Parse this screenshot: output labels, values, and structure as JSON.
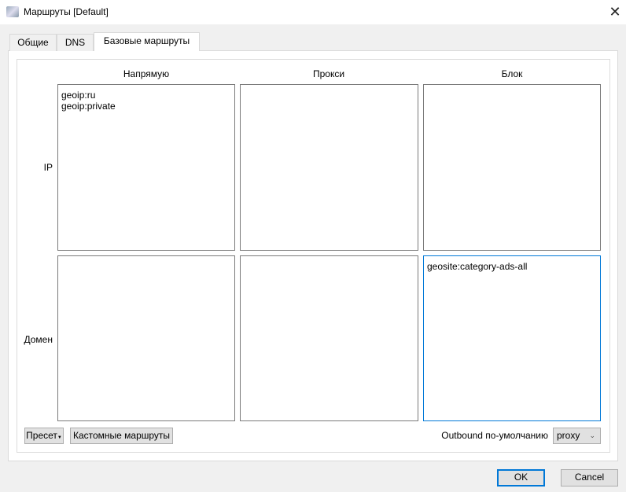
{
  "window": {
    "title": "Маршруты [Default]"
  },
  "tabs": [
    {
      "label": "Общие"
    },
    {
      "label": "DNS"
    },
    {
      "label": "Базовые маршруты"
    }
  ],
  "columns": [
    "Напрямую",
    "Прокси",
    "Блок"
  ],
  "rows": [
    "IP",
    "Домен"
  ],
  "rules": {
    "ip": {
      "direct": "geoip:ru\ngeoip:private",
      "proxy": "",
      "block": ""
    },
    "domain": {
      "direct": "",
      "proxy": "",
      "block": "geosite:category-ads-all"
    }
  },
  "buttons": {
    "preset": "Пресет",
    "custom": "Кастомные маршруты",
    "ok": "OK",
    "cancel": "Cancel"
  },
  "outbound": {
    "label": "Outbound по-умолчанию",
    "value": "proxy"
  }
}
